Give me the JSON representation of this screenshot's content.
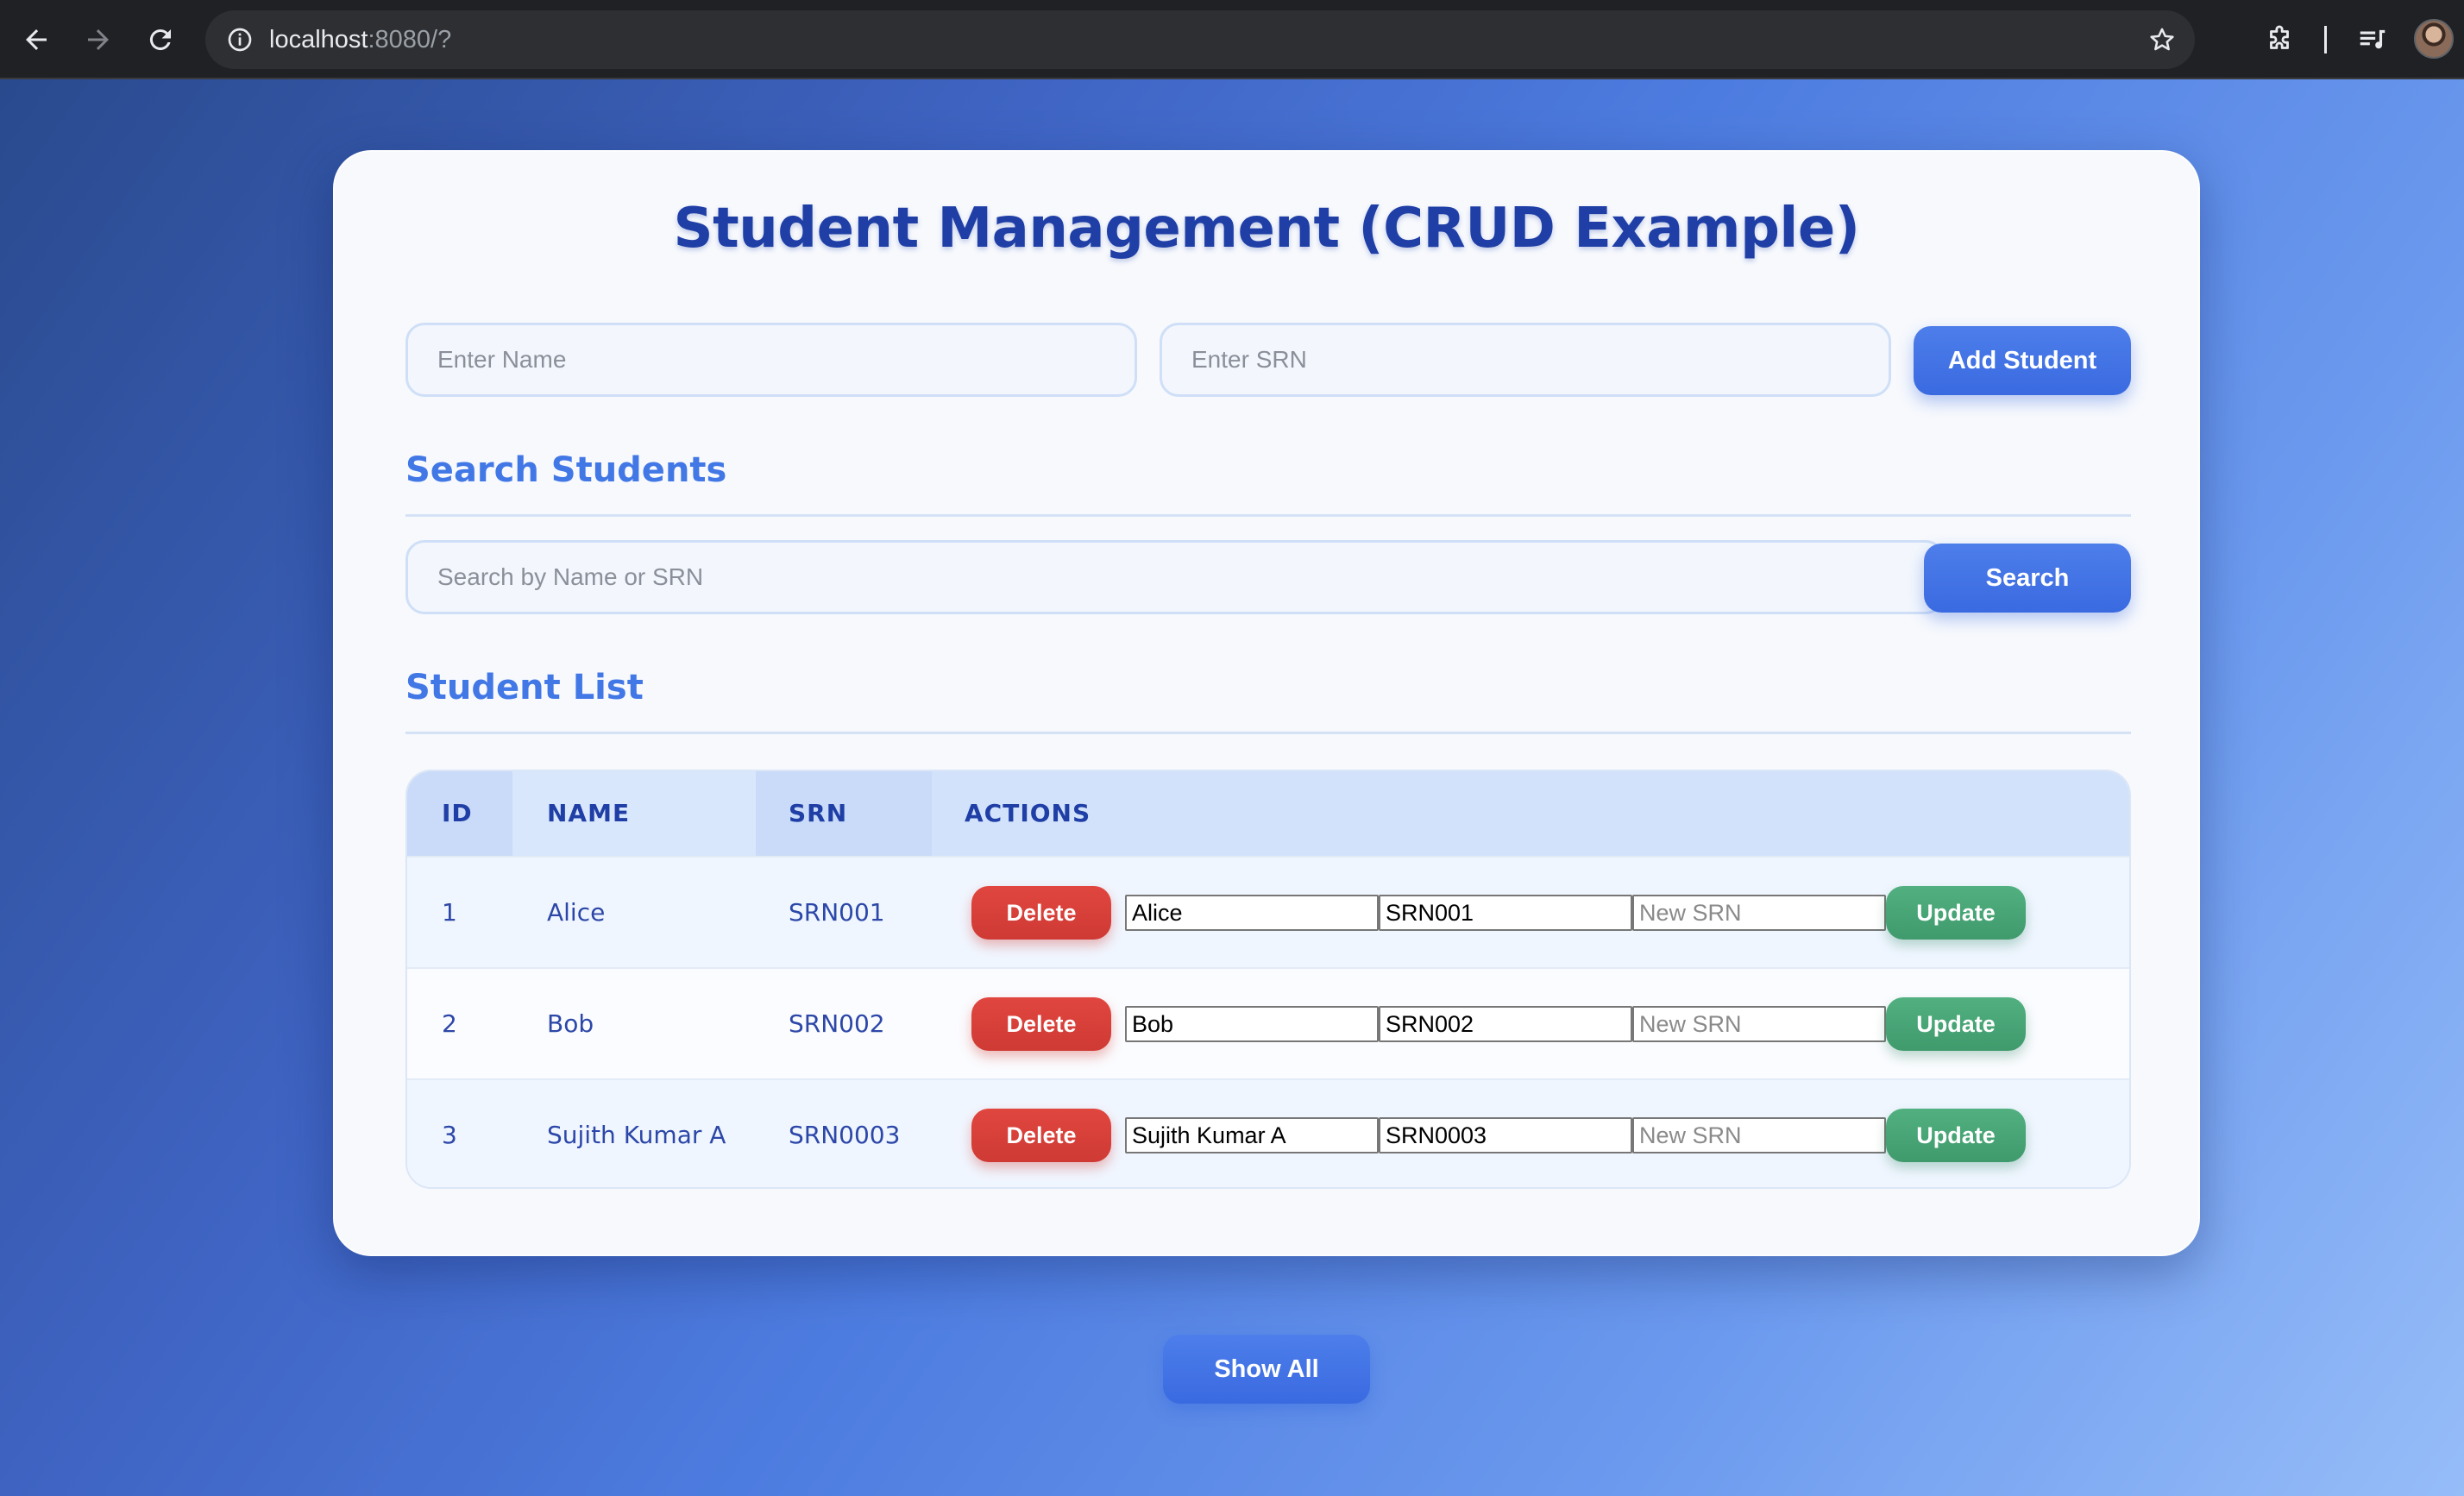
{
  "browser": {
    "url_host": "localhost",
    "url_rest": ":8080/?"
  },
  "page": {
    "title": "Student Management (CRUD Example)",
    "add_form": {
      "name_placeholder": "Enter Name",
      "srn_placeholder": "Enter SRN",
      "add_button": "Add Student"
    },
    "search": {
      "heading": "Search Students",
      "placeholder": "Search by Name or SRN",
      "button": "Search"
    },
    "list": {
      "heading": "Student List",
      "columns": [
        "ID",
        "NAME",
        "SRN",
        "ACTIONS"
      ],
      "rows": [
        {
          "id": "1",
          "name": "Alice",
          "srn": "SRN001",
          "edit_name": "Alice",
          "edit_srn": "SRN001",
          "new_srn_placeholder": "New SRN"
        },
        {
          "id": "2",
          "name": "Bob",
          "srn": "SRN002",
          "edit_name": "Bob",
          "edit_srn": "SRN002",
          "new_srn_placeholder": "New SRN"
        },
        {
          "id": "3",
          "name": "Sujith Kumar A",
          "srn": "SRN0003",
          "edit_name": "Sujith Kumar A",
          "edit_srn": "SRN0003",
          "new_srn_placeholder": "New SRN"
        }
      ],
      "delete_label": "Delete",
      "update_label": "Update"
    },
    "show_all_button": "Show All"
  },
  "colors": {
    "title": "#1f3fa6",
    "section_heading": "#4277e6",
    "primary_button": "#3f6fe4",
    "delete_button": "#d8403a",
    "update_button": "#47a574"
  },
  "icons": {
    "back": "arrow-left-icon",
    "forward": "arrow-right-icon",
    "reload": "reload-icon",
    "site_info": "info-icon",
    "bookmark": "star-icon",
    "extensions": "puzzle-icon",
    "media": "playlist-music-icon",
    "profile": "avatar"
  }
}
